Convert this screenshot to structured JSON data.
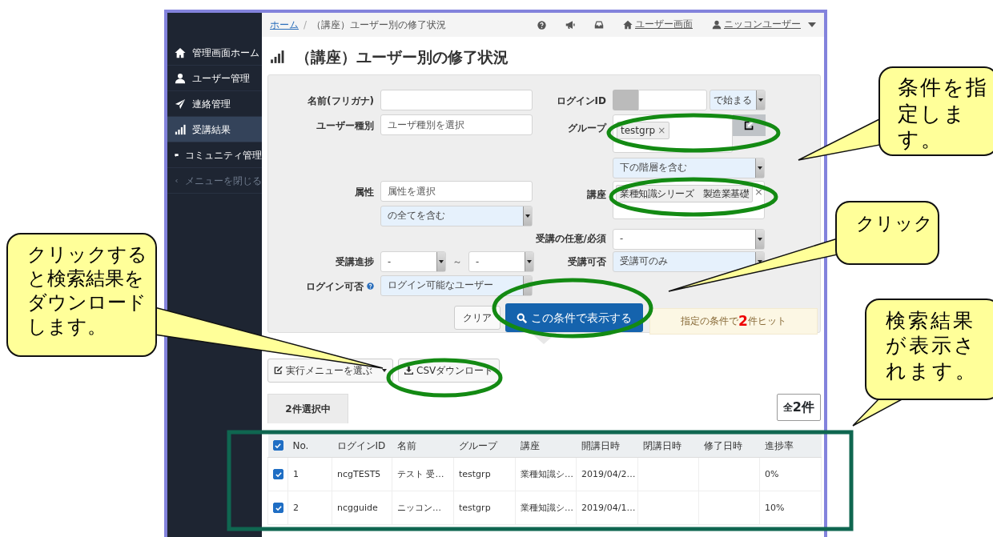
{
  "breadcrumb": {
    "home": "ホーム",
    "separator": "/",
    "current": "（講座）ユーザー別の修了状況"
  },
  "header_links": [
    "ユーザー画面",
    "ニッコンユーザー"
  ],
  "sidebar": {
    "items": [
      {
        "label": "管理画面ホーム",
        "selected": false
      },
      {
        "label": "ユーザー管理",
        "selected": false
      },
      {
        "label": "連絡管理",
        "selected": false
      },
      {
        "label": "受講結果",
        "selected": true
      },
      {
        "label": "コミュニティ管理",
        "selected": false
      }
    ],
    "collapse": "メニューを閉じる"
  },
  "page_title": "（講座）ユーザー別の修了状況",
  "filters": {
    "name": {
      "label": "名前(フリガナ)"
    },
    "user_type": {
      "label": "ユーザー種別",
      "placeholder": "ユーザ種別を選択"
    },
    "attribute": {
      "label": "属性",
      "placeholder": "属性を選択",
      "match": {
        "value": "の全てを含む",
        "filled": true
      }
    },
    "progress": {
      "label": "受講進捗",
      "from": {
        "value": "-",
        "filled": false
      },
      "separator": "～",
      "to": {
        "value": "-",
        "filled": false
      }
    },
    "login_allowed": {
      "label": "ログイン可否",
      "value": "ログイン可能なユーザー",
      "filled": true
    },
    "login_id": {
      "label": "ログインID",
      "match": {
        "value": "で始まる",
        "filled": true
      }
    },
    "group": {
      "label": "グループ",
      "tags": [
        {
          "label": "testgrp",
          "remove": "×"
        }
      ],
      "scope": {
        "value": "下の階層を含む",
        "filled": true
      }
    },
    "course": {
      "label": "講座",
      "tags": [
        {
          "label": "業種知識シリーズ　製造業基礎"
        }
      ],
      "clear": "×"
    },
    "required": {
      "label": "受講の任意/必須",
      "value": "-",
      "filled": false
    },
    "enrollable": {
      "label": "受講可否",
      "value": "受講可のみ",
      "filled": true
    }
  },
  "actions": {
    "clear": "クリア",
    "search": "この条件で表示する",
    "hit_summary": "指定の条件で**2**件ヒット"
  },
  "toolbar": {
    "menu": "実行メニューを選ぶ",
    "csv": "CSVダウンロード"
  },
  "selection_tab": "2件選択中",
  "total": "全**2件**",
  "table": {
    "all_checked": true,
    "columns": [
      "No.",
      "ログインID",
      "名前",
      "グループ",
      "講座",
      "開講日時",
      "閉講日時",
      "修了日時",
      "進捗率"
    ],
    "rows": [
      {
        "checked": true,
        "cells": [
          "1",
          "ncgTEST5",
          "テスト 受…",
          "testgrp",
          "業種知識シ…",
          "2019/04/2…",
          null,
          null,
          "0%"
        ]
      },
      {
        "checked": true,
        "cells": [
          "2",
          "ncgguide",
          "ニッコン…",
          "testgrp",
          "業種知識シ…",
          "2019/04/1…",
          null,
          null,
          "10%"
        ]
      }
    ]
  },
  "callouts": [
    "条件を指定します。",
    "クリック",
    "クリックすると検索結果をダウンロードします。",
    "検索結果が表示されます。"
  ]
}
